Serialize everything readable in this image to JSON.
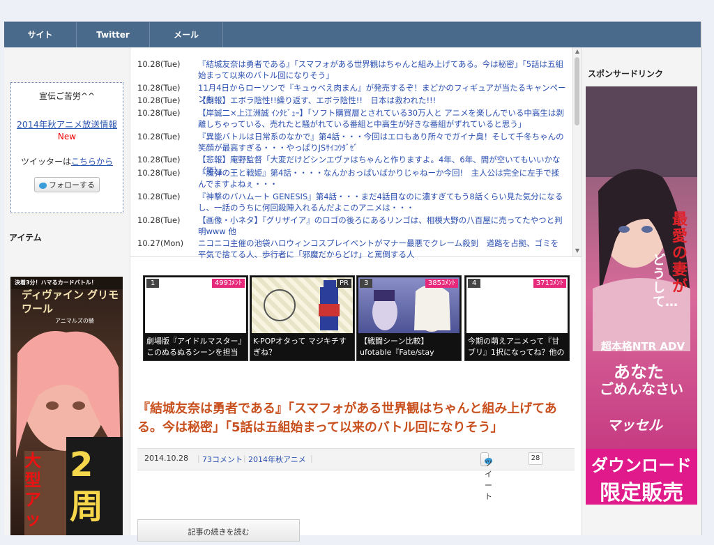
{
  "nav": {
    "items": [
      "サイト",
      "Twitter",
      "メール"
    ]
  },
  "left": {
    "greeting": "宣伝ご苦労^^",
    "anime_link": "2014年秋アニメ放送情報",
    "new_label": "New",
    "twitter_prefix": "ツイッターは",
    "twitter_link": "こちらから",
    "follow_button": "フォローする",
    "items_heading": "アイテム",
    "banner_top": "決着3分！ハマるカードバトル！",
    "banner_title": "ディヴァイン グリモワール",
    "banner_sub": "アニマルズの騎",
    "banner_big": "大型アッ",
    "banner_num": "2周"
  },
  "right": {
    "heading": "スポンサードリンク",
    "ad_line1": "最愛の妻が",
    "ad_line2": "どうして…",
    "ad_line3": "超本格NTR ADV",
    "ad_line4": "あなた",
    "ad_line5": "ごめんなさい",
    "ad_logo": "マッセル",
    "ad_line6": "ダウンロード",
    "ad_line7": "限定販売"
  },
  "news": [
    {
      "date": "10.28(Tue)",
      "title": "『結城友奈は勇者である』「スマフォがある世界観はちゃんと組み上げてある。今は秘密」「5話は五組始まって以来のバトル回になりそう」"
    },
    {
      "date": "10.28(Tue)",
      "title": "11月4日からローソンで『キュゥべえ肉まん』が発売するぞ！まどかのフィギュアが当たるキャンペーンも"
    },
    {
      "date": "10.28(Tue)",
      "title": "【朗報】エボラ陰性!!繰り返す、エボラ陰性!!　日本は救われた!!!"
    },
    {
      "date": "10.28(Tue)",
      "title": "【岸誠二×上江洲誠 ｲﾝﾀﾋﾞｭｰ】「ソフト購買層とされている30万人と アニメを楽しんでいる中高生は剥離しちゃっている、売れたと騒がれている番組と中高生が好きな番組がずれていると思う」"
    },
    {
      "date": "10.28(Tue)",
      "title": "『異能バトルは日常系のなかで』第4話・・・今回はエロもあり所々でガイナ臭！そして千冬ちゃんの笑顔が最高すぎる・・・やっぱりJSｻｲｺｳﾀﾞｾﾞ"
    },
    {
      "date": "10.28(Tue)",
      "title": "【悲報】庵野監督「大変だけどシンエヴァはちゃんと作りますよ。4年、6年、間が空いてもいいかな（笑）」"
    },
    {
      "date": "10.28(Tue)",
      "title": "『魔弾の王と戦姫』第4話・・・・なんかおっぱいばかりじゃねーか今回!　主人公は完全に左手で揉んでますよねぇ・・・"
    },
    {
      "date": "10.28(Tue)",
      "title": "『神撃のバハムート GENESIS』第4話・・・まだ4話目なのに濃すぎてもう8話くらい見た気分になるし、一話のうちに何回殺陣入れるんだよこのアニメは・・・"
    },
    {
      "date": "10.28(Tue)",
      "title": "【画像・小ネタ】『グリザイア』のロゴの後ろにあるリンゴは、相模大野の八百屋に売ってたやつと判明www 他"
    },
    {
      "date": "10.27(Mon)",
      "title": "ニコニコ主催の池袋ハロウィンコスプレイベントがマナー最悪でクレーム殺到　道路を占拠、ゴミを平気で捨てる人、歩行者に「邪魔だからどけ」と罵倒する人"
    }
  ],
  "thumbs": [
    {
      "num": "1",
      "count": "499ｺﾒﾝﾄ",
      "caption1": "劇場版『アイドルマスター』",
      "caption2": "このぬるぬるシーンを担当"
    },
    {
      "num": "",
      "count": "PR",
      "caption1": "K-POPオタって マジキチす",
      "caption2": "ぎね？"
    },
    {
      "num": "3",
      "count": "385ｺﾒﾝﾄ",
      "caption1": "【戦闘シーン比較】",
      "caption2": "ufotable『Fate/stay"
    },
    {
      "num": "4",
      "count": "371ｺﾒﾝﾄ",
      "caption1": "今期の萌えアニメって『甘",
      "caption2": "ブリ』1択になってね？他の"
    }
  ],
  "article": {
    "title": "『結城友奈は勇者である』「スマフォがある世界観はちゃんと組み上げてある。今は秘密」「5話は五組始まって以来のバトル回になりそう」",
    "date": "2014.10.28",
    "comments": "73コメント",
    "category": "2014年秋アニメ",
    "tweet": "ツイート",
    "tweet_count": "28",
    "read_more": "記事の続きを読む"
  },
  "colors": {
    "nav": "#4a6a8c",
    "link": "#2a4fb0",
    "title": "#c8501e",
    "badge": "#e6297a"
  }
}
